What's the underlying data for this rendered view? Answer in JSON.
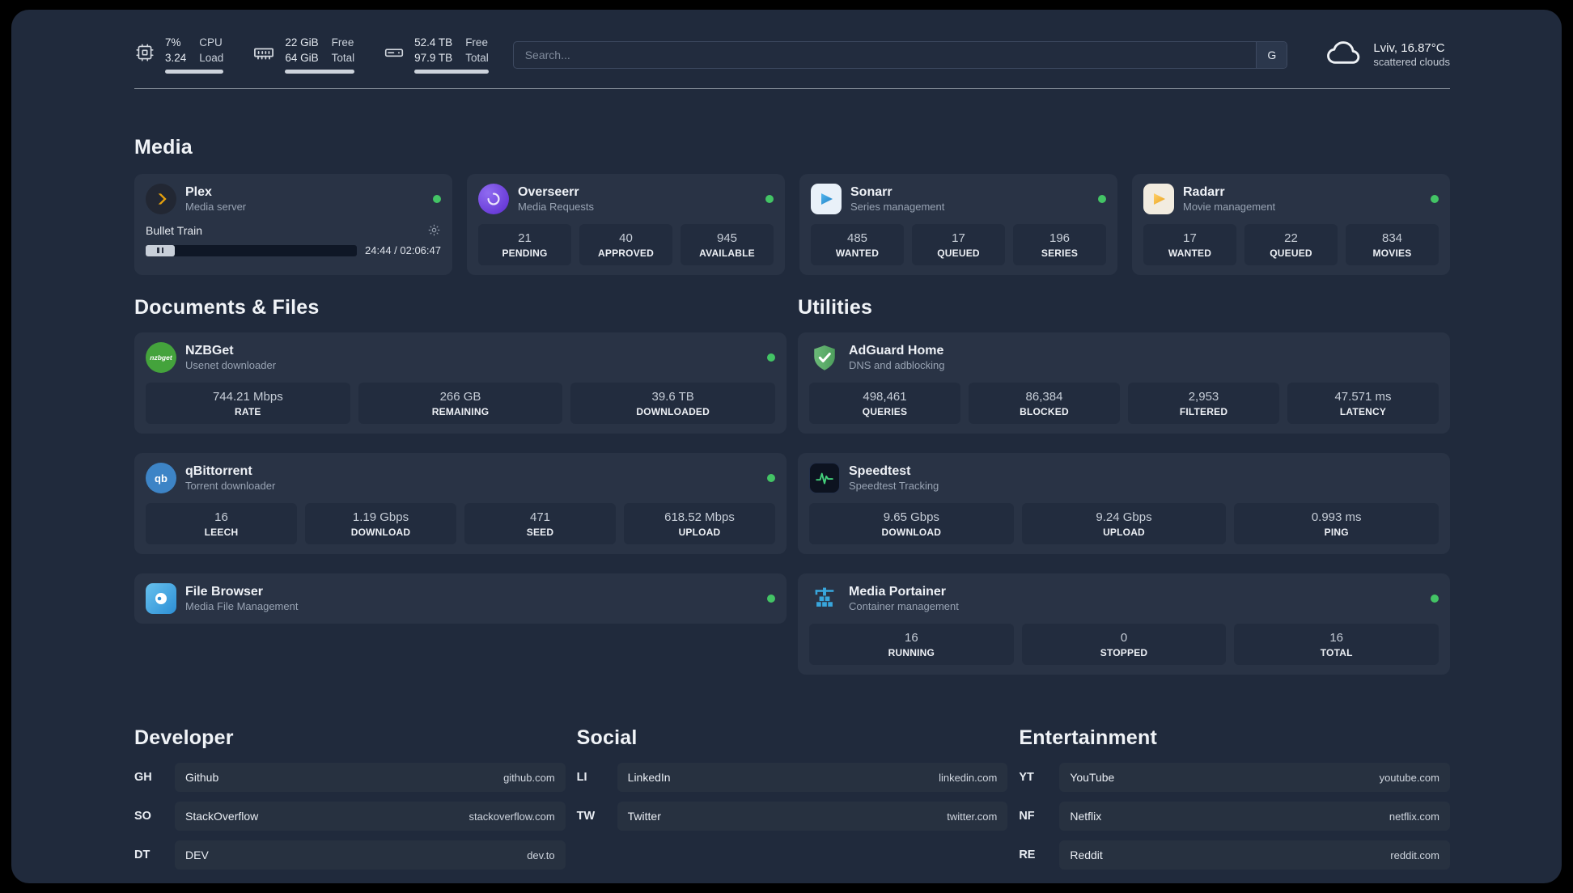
{
  "topbar": {
    "cpu": {
      "icon": "cpu-icon",
      "percent": "7%",
      "load": "3.24",
      "label_top": "CPU",
      "label_bottom": "Load"
    },
    "ram": {
      "icon": "ram-icon",
      "free": "22 GiB",
      "total": "64 GiB",
      "free_label": "Free",
      "total_label": "Total"
    },
    "disk": {
      "icon": "disk-icon",
      "free": "52.4 TB",
      "total": "97.9 TB",
      "free_label": "Free",
      "total_label": "Total"
    },
    "search": {
      "placeholder": "Search...",
      "engine": "G"
    },
    "weather": {
      "icon": "cloud-icon",
      "location": "Lviv, 16.87°C",
      "condition": "scattered clouds"
    }
  },
  "media": {
    "heading": "Media",
    "plex": {
      "icon": "plex-icon",
      "title": "Plex",
      "subtitle": "Media server",
      "now_playing": "Bullet Train",
      "time": "24:44 / 02:06:47"
    },
    "overseerr": {
      "icon": "overseerr-icon",
      "title": "Overseerr",
      "subtitle": "Media Requests",
      "stats": [
        {
          "value": "21",
          "label": "PENDING"
        },
        {
          "value": "40",
          "label": "APPROVED"
        },
        {
          "value": "945",
          "label": "AVAILABLE"
        }
      ]
    },
    "sonarr": {
      "icon": "sonarr-icon",
      "title": "Sonarr",
      "subtitle": "Series management",
      "stats": [
        {
          "value": "485",
          "label": "WANTED"
        },
        {
          "value": "17",
          "label": "QUEUED"
        },
        {
          "value": "196",
          "label": "SERIES"
        }
      ]
    },
    "radarr": {
      "icon": "radarr-icon",
      "title": "Radarr",
      "subtitle": "Movie management",
      "stats": [
        {
          "value": "17",
          "label": "WANTED"
        },
        {
          "value": "22",
          "label": "QUEUED"
        },
        {
          "value": "834",
          "label": "MOVIES"
        }
      ]
    }
  },
  "documents": {
    "heading": "Documents & Files",
    "nzbget": {
      "icon": "nzbget-icon",
      "icon_text": "nzbget",
      "title": "NZBGet",
      "subtitle": "Usenet downloader",
      "stats": [
        {
          "value": "744.21 Mbps",
          "label": "RATE"
        },
        {
          "value": "266 GB",
          "label": "REMAINING"
        },
        {
          "value": "39.6 TB",
          "label": "DOWNLOADED"
        }
      ]
    },
    "qbittorrent": {
      "icon": "qbittorrent-icon",
      "icon_text": "qb",
      "title": "qBittorrent",
      "subtitle": "Torrent downloader",
      "stats": [
        {
          "value": "16",
          "label": "LEECH"
        },
        {
          "value": "1.19 Gbps",
          "label": "DOWNLOAD"
        },
        {
          "value": "471",
          "label": "SEED"
        },
        {
          "value": "618.52 Mbps",
          "label": "UPLOAD"
        }
      ]
    },
    "filebrowser": {
      "icon": "filebrowser-icon",
      "title": "File Browser",
      "subtitle": "Media File Management"
    }
  },
  "utilities": {
    "heading": "Utilities",
    "adguard": {
      "icon": "adguard-icon",
      "title": "AdGuard Home",
      "subtitle": "DNS and adblocking",
      "stats": [
        {
          "value": "498,461",
          "label": "QUERIES"
        },
        {
          "value": "86,384",
          "label": "BLOCKED"
        },
        {
          "value": "2,953",
          "label": "FILTERED"
        },
        {
          "value": "47.571 ms",
          "label": "LATENCY"
        }
      ]
    },
    "speedtest": {
      "icon": "speedtest-icon",
      "title": "Speedtest",
      "subtitle": "Speedtest Tracking",
      "stats": [
        {
          "value": "9.65 Gbps",
          "label": "DOWNLOAD"
        },
        {
          "value": "9.24 Gbps",
          "label": "UPLOAD"
        },
        {
          "value": "0.993 ms",
          "label": "PING"
        }
      ]
    },
    "portainer": {
      "icon": "portainer-icon",
      "title": "Media Portainer",
      "subtitle": "Container management",
      "stats": [
        {
          "value": "16",
          "label": "RUNNING"
        },
        {
          "value": "0",
          "label": "STOPPED"
        },
        {
          "value": "16",
          "label": "TOTAL"
        }
      ]
    }
  },
  "links": {
    "developer": {
      "heading": "Developer",
      "items": [
        {
          "abbr": "GH",
          "name": "Github",
          "url": "github.com"
        },
        {
          "abbr": "SO",
          "name": "StackOverflow",
          "url": "stackoverflow.com"
        },
        {
          "abbr": "DT",
          "name": "DEV",
          "url": "dev.to"
        }
      ]
    },
    "social": {
      "heading": "Social",
      "items": [
        {
          "abbr": "LI",
          "name": "LinkedIn",
          "url": "linkedin.com"
        },
        {
          "abbr": "TW",
          "name": "Twitter",
          "url": "twitter.com"
        }
      ]
    },
    "entertainment": {
      "heading": "Entertainment",
      "items": [
        {
          "abbr": "YT",
          "name": "YouTube",
          "url": "youtube.com"
        },
        {
          "abbr": "NF",
          "name": "Netflix",
          "url": "netflix.com"
        },
        {
          "abbr": "RE",
          "name": "Reddit",
          "url": "reddit.com"
        }
      ]
    }
  }
}
